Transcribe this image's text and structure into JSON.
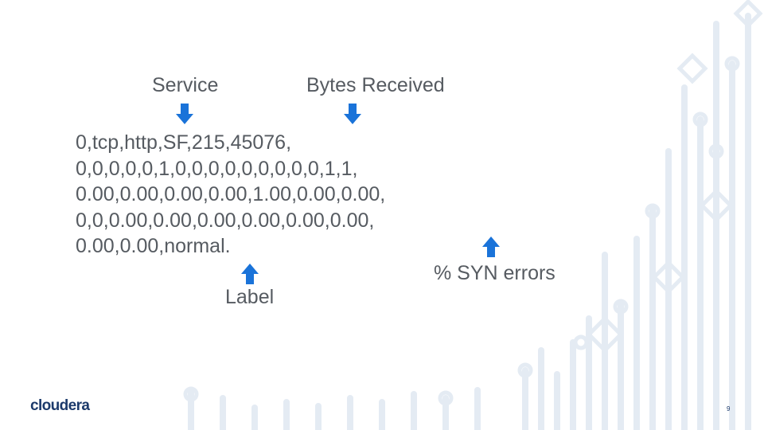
{
  "labels": {
    "service": "Service",
    "bytes_received": "Bytes Received",
    "label": "Label",
    "syn_errors": "% SYN errors"
  },
  "record_lines": [
    "0,tcp,http,SF,215,45076,",
    "0,0,0,0,0,1,0,0,0,0,0,0,0,0,0,1,1,",
    "0.00,0.00,0.00,0.00,1.00,0.00,0.00,",
    "0,0,0.00,0.00,0.00,0.00,0.00,0.00,",
    "0.00,0.00,normal."
  ],
  "footer": {
    "logo": "cloudera",
    "page_number": "9"
  },
  "colors": {
    "arrow": "#1a73d9",
    "text": "#565b61",
    "logo": "#1c3a6b",
    "deco": "#e3ebf4"
  }
}
